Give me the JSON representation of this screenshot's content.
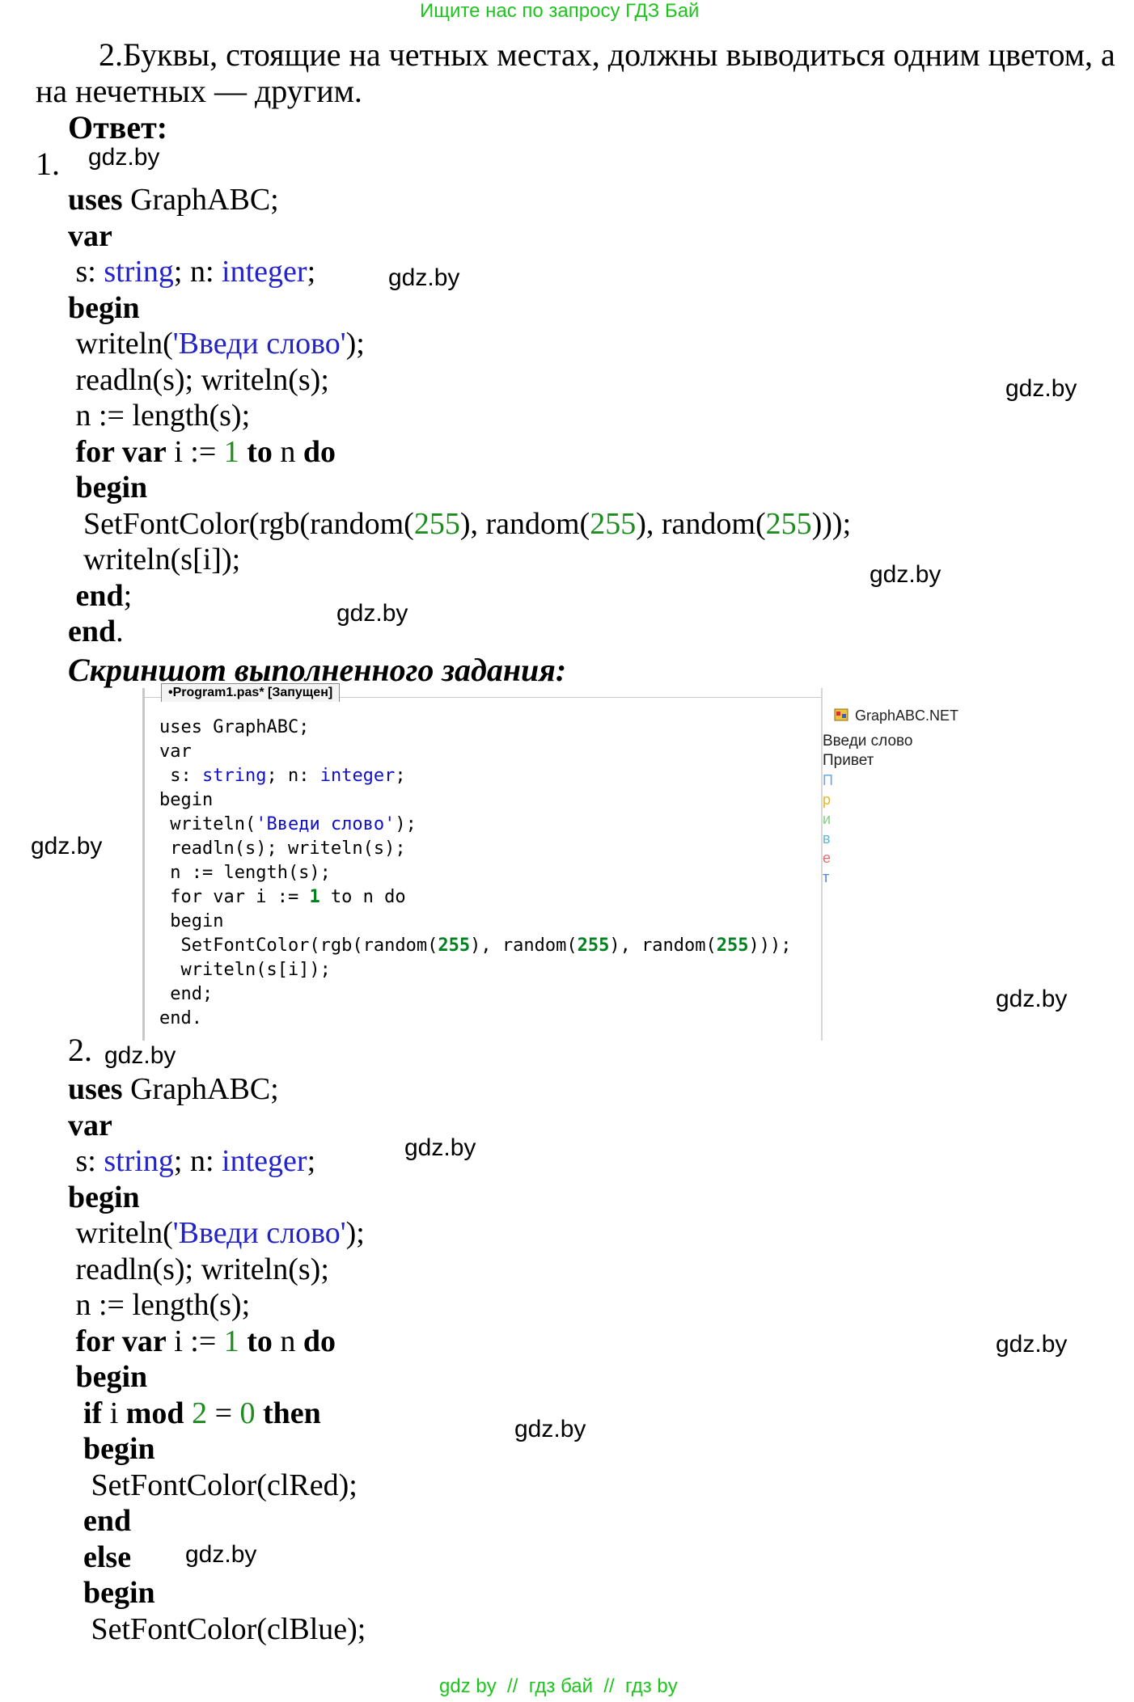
{
  "header": {
    "text": "Ищите нас по запросу ГДЗ Бай"
  },
  "intro": {
    "line1": "2.Буквы, стоящие на четных местах, должны выводиться одним цветом, а",
    "line2": "на нечетных — другим."
  },
  "answer_label": "Ответ:",
  "item1_num": "1.",
  "item2_num": "2.",
  "watermark": "gdz.by",
  "code1": {
    "uses_kw": "uses",
    "uses_rest": " GraphABC;",
    "var_kw": "var",
    "s_decl": " s: ",
    "string_ty": "string",
    "semi_n": "; n: ",
    "integer_ty": "integer",
    "semi": ";",
    "begin_kw": "begin",
    "writeln_open": " writeln(",
    "str_vvedi": "'Введи слово'",
    "writeln_close": ");",
    "readln_line": " readln(s); writeln(s);",
    "n_len": " n := length(s);",
    "for_kw": " for var",
    "for_i": " i := ",
    "one": "1",
    "to_kw": " to",
    "n_space": " n ",
    "do_kw": "do",
    "begin2_kw": " begin",
    "setfont_a": "  SetFontColor(rgb(random(",
    "n255": "255",
    "setfont_b": "), random(",
    "setfont_c": "), random(",
    "setfont_d": ")));",
    "writeln_si": "  writeln(s[i]);",
    "end_inner_kw": " end",
    "end_inner_semi": ";",
    "end_outer_kw": "end",
    "end_outer_dot": "."
  },
  "screenshot_caption": "Скриншот выполненного задания:",
  "screenshot": {
    "tab_label": "•Program1.pas* [Запущен]",
    "output_title": "GraphABC.NET",
    "output_line1": "Введи слово",
    "output_line2": "Привет",
    "letters": [
      {
        "ch": "П",
        "color": "#6aa8e8"
      },
      {
        "ch": "р",
        "color": "#e8b820"
      },
      {
        "ch": "и",
        "color": "#7ad47a"
      },
      {
        "ch": "в",
        "color": "#64b4d8"
      },
      {
        "ch": "е",
        "color": "#e86a6a"
      },
      {
        "ch": "т",
        "color": "#4a8ad8"
      }
    ],
    "code": {
      "l1": "uses GraphABC;",
      "l2": "var",
      "l3a": " s: ",
      "l3b": "string",
      "l3c": "; n: ",
      "l3d": "integer",
      "l3e": ";",
      "l4": "begin",
      "l5a": " writeln(",
      "l5b": "'Введи слово'",
      "l5c": ");",
      "l6": " readln(s); writeln(s);",
      "l7": " n := length(s);",
      "l8a": " for var i := ",
      "l8b": "1",
      "l8c": " to n do",
      "l9": " begin",
      "l10a": "  SetFontColor(rgb(random(",
      "l10b": "255",
      "l10c": "), random(",
      "l10d": "255",
      "l10e": "), random(",
      "l10f": "255",
      "l10g": ")));",
      "l11": "  writeln(s[i]);",
      "l12": " end;",
      "l13": "end."
    }
  },
  "code2": {
    "uses_kw": "uses",
    "uses_rest": " GraphABC;",
    "var_kw": "var",
    "s_decl": " s: ",
    "string_ty": "string",
    "semi_n": "; n: ",
    "integer_ty": "integer",
    "semi": ";",
    "begin_kw": "begin",
    "writeln_open": " writeln(",
    "str_vvedi": "'Введи слово'",
    "writeln_close": ");",
    "readln_line": " readln(s); writeln(s);",
    "n_len": " n := length(s);",
    "for_kw": " for var",
    "for_i": " i := ",
    "one": "1",
    "to_kw": " to",
    "n_space": " n ",
    "do_kw": "do",
    "begin2_kw": " begin",
    "if_kw": "  if",
    "if_i": " i ",
    "mod_kw": "mod",
    "sp2": " ",
    "two": "2",
    "eq": " = ",
    "zero": "0",
    "then_kw": " then",
    "begin3_kw": "  begin",
    "setred": "   SetFontColor(clRed);",
    "end3_kw": "  end",
    "else_kw": "  else",
    "begin4_kw": "  begin",
    "setblue": "   SetFontColor(clBlue);"
  },
  "footer": {
    "text": "gdz by  //  гдз бай  //  гдз by"
  }
}
